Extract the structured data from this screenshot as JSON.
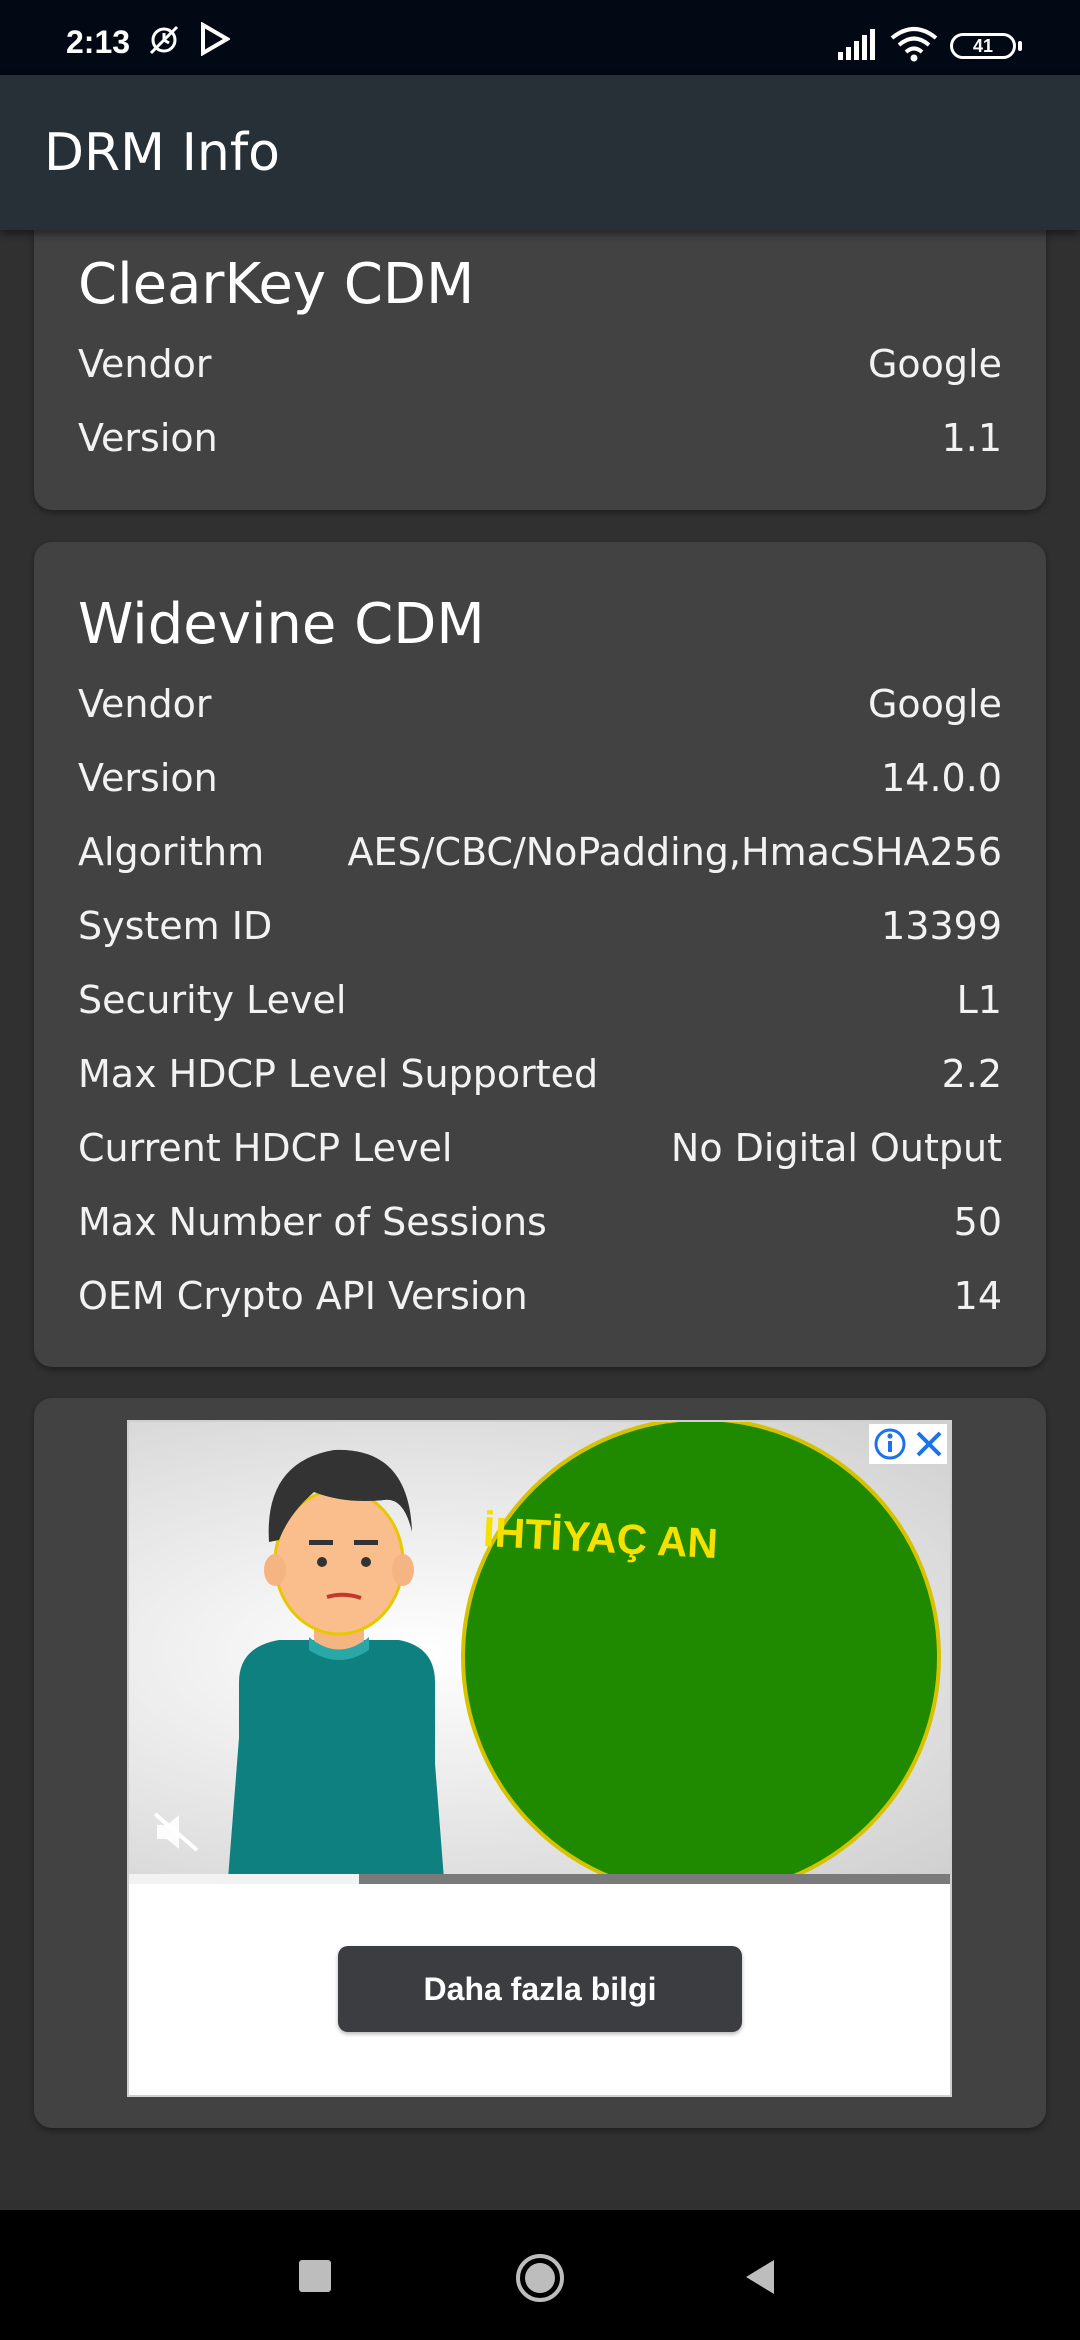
{
  "status_bar": {
    "time": "2:13",
    "battery": "41",
    "icons": [
      "alarm-off-icon",
      "play-store-icon",
      "signal-icon",
      "wifi-icon",
      "battery-icon"
    ]
  },
  "app_bar": {
    "title": "DRM Info"
  },
  "clearkey": {
    "title": "ClearKey CDM",
    "rows": [
      {
        "label": "Vendor",
        "value": "Google"
      },
      {
        "label": "Version",
        "value": "1.1"
      }
    ]
  },
  "widevine": {
    "title": "Widevine CDM",
    "rows": [
      {
        "label": "Vendor",
        "value": "Google"
      },
      {
        "label": "Version",
        "value": "14.0.0"
      },
      {
        "label": "Algorithm",
        "value": "AES/CBC/NoPadding,HmacSHA256"
      },
      {
        "label": "System ID",
        "value": "13399"
      },
      {
        "label": "Security Level",
        "value": "L1"
      },
      {
        "label": "Max HDCP Level Supported",
        "value": "2.2"
      },
      {
        "label": "Current HDCP Level",
        "value": "No Digital Output"
      },
      {
        "label": "Max Number of Sessions",
        "value": "50"
      },
      {
        "label": "OEM Crypto API Version",
        "value": "14"
      }
    ]
  },
  "ad": {
    "video_text": "İHTİYAÇ AN",
    "cta_label": "Daha fazla bilgi",
    "progress": 0.28,
    "icons": [
      "info-icon",
      "close-icon",
      "mute-icon"
    ]
  },
  "colors": {
    "status_bar": "#020814",
    "app_bar": "#263036",
    "background": "#303030",
    "card": "#424242",
    "ad_green": "#1f8a00",
    "ad_text_yellow": "#f5e000",
    "ad_blue": "#1a73e8"
  },
  "nav_bar": {
    "icons": [
      "recents-icon",
      "home-icon",
      "back-icon"
    ]
  }
}
